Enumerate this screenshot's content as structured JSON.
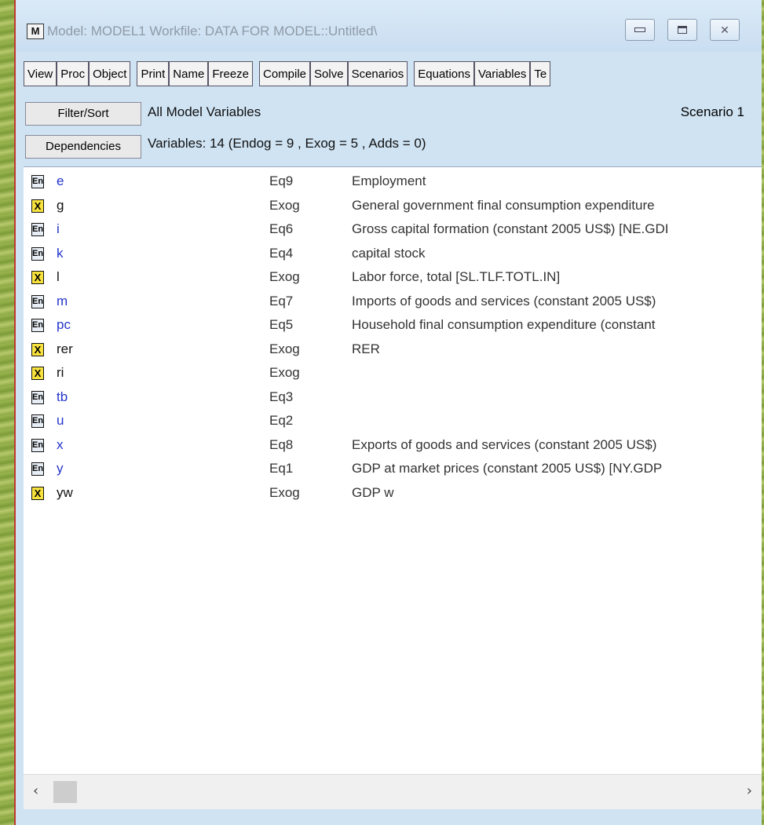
{
  "window": {
    "title": "Model: MODEL1   Workfile: DATA FOR MODEL::Untitled\\",
    "icon_letter": "M"
  },
  "toolbar": {
    "groups": [
      [
        "View",
        "Proc",
        "Object"
      ],
      [
        "Print",
        "Name",
        "Freeze"
      ],
      [
        "Compile",
        "Solve",
        "Scenarios"
      ],
      [
        "Equations",
        "Variables",
        "Te"
      ]
    ]
  },
  "panel": {
    "filter_label": "Filter/Sort",
    "dependencies_label": "Dependencies",
    "heading": "All Model Variables",
    "summary": "Variables: 14  (Endog = 9 , Exog = 5 , Adds = 0)",
    "scenario": "Scenario 1"
  },
  "variables": [
    {
      "badge": "En",
      "type": "en",
      "name": "e",
      "eq": "Eq9",
      "desc": "Employment"
    },
    {
      "badge": "X",
      "type": "x",
      "name": "g",
      "eq": "Exog",
      "desc": "General government final consumption expenditure"
    },
    {
      "badge": "En",
      "type": "en",
      "name": "i",
      "eq": "Eq6",
      "desc": "Gross capital formation (constant 2005 US$) [NE.GDI"
    },
    {
      "badge": "En",
      "type": "en",
      "name": "k",
      "eq": "Eq4",
      "desc": "capital stock"
    },
    {
      "badge": "X",
      "type": "x",
      "name": "l",
      "eq": "Exog",
      "desc": "Labor force, total [SL.TLF.TOTL.IN]"
    },
    {
      "badge": "En",
      "type": "en",
      "name": "m",
      "eq": "Eq7",
      "desc": "Imports of goods and services (constant 2005 US$)"
    },
    {
      "badge": "En",
      "type": "en",
      "name": "pc",
      "eq": "Eq5",
      "desc": "Household final consumption expenditure (constant"
    },
    {
      "badge": "X",
      "type": "x",
      "name": "rer",
      "eq": "Exog",
      "desc": "RER"
    },
    {
      "badge": "X",
      "type": "x",
      "name": "ri",
      "eq": "Exog",
      "desc": ""
    },
    {
      "badge": "En",
      "type": "en",
      "name": "tb",
      "eq": "Eq3",
      "desc": ""
    },
    {
      "badge": "En",
      "type": "en",
      "name": "u",
      "eq": "Eq2",
      "desc": ""
    },
    {
      "badge": "En",
      "type": "en",
      "name": "x",
      "eq": "Eq8",
      "desc": "Exports of goods and services (constant 2005 US$)"
    },
    {
      "badge": "En",
      "type": "en",
      "name": "y",
      "eq": "Eq1",
      "desc": "GDP at market prices (constant 2005 US$) [NY.GDP"
    },
    {
      "badge": "X",
      "type": "x",
      "name": "yw",
      "eq": "Exog",
      "desc": "GDP w"
    }
  ],
  "icons": {
    "minimize": "minimize-icon",
    "maximize": "maximize-icon",
    "close": "close-icon",
    "scroll_left": "chevron-left-icon",
    "scroll_right": "chevron-right-icon"
  }
}
